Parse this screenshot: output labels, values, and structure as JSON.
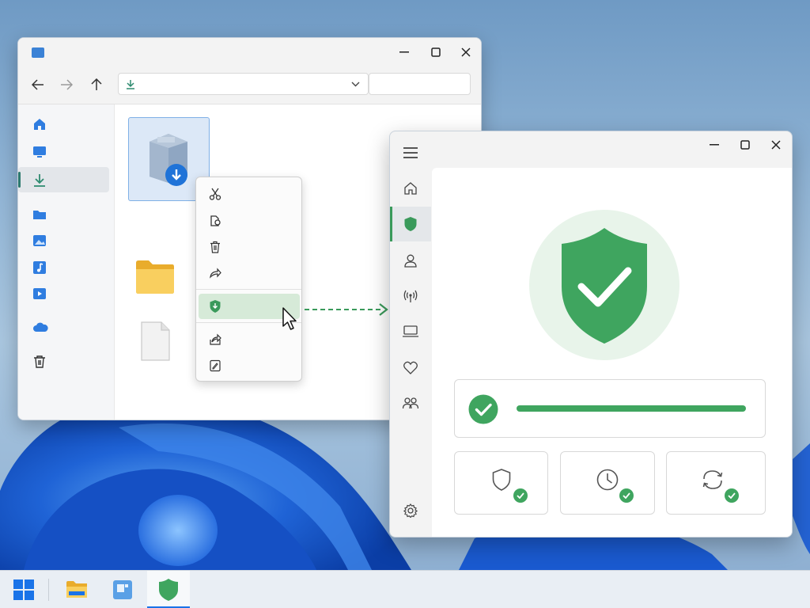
{
  "explorer": {
    "address_path": "",
    "search_placeholder": "",
    "sidebar": [
      "home-icon",
      "desktop-icon",
      "downloads-icon",
      "folder-icon",
      "pictures-icon",
      "music-icon",
      "videos-icon",
      "cloud-icon",
      "recycle-bin-icon"
    ],
    "files": [
      "package-installer-icon",
      "folder-icon",
      "document-icon"
    ],
    "context_menu": [
      "cut-icon",
      "copy-icon",
      "delete-icon",
      "share-icon",
      "scan-shield-icon",
      "share-out-icon",
      "edit-icon"
    ]
  },
  "security": {
    "nav": [
      "home-icon",
      "shield-icon",
      "account-icon",
      "network-icon",
      "device-icon",
      "health-icon",
      "family-icon",
      "settings-icon"
    ],
    "status_progress": 1.0,
    "tiles": [
      "shield-icon",
      "clock-icon",
      "sync-icon"
    ]
  },
  "taskbar": {
    "apps": [
      "start-icon",
      "file-explorer-icon",
      "store-icon",
      "security-icon"
    ],
    "active": "security-icon"
  },
  "colors": {
    "accent_green": "#3fa55f",
    "accent_blue": "#1a73e8",
    "folder_yellow": "#f4c74f"
  }
}
